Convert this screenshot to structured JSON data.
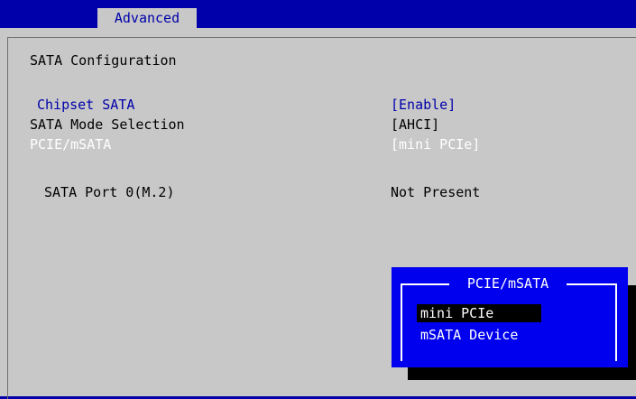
{
  "tabs": {
    "active": "Advanced"
  },
  "page": {
    "title": "SATA Configuration"
  },
  "settings": [
    {
      "label": "Chipset SATA",
      "value": "[Enable]"
    },
    {
      "label": "SATA Mode Selection",
      "value": "[AHCI]"
    },
    {
      "label": "PCIE/mSATA",
      "value": "[mini PCIe]"
    }
  ],
  "port": {
    "label": "SATA Port 0(M.2)",
    "value": "Not Present"
  },
  "popup": {
    "title": "PCIE/mSATA",
    "options": [
      "mini PCIe",
      "mSATA Device"
    ],
    "selected": "mini PCIe"
  },
  "colors": {
    "background": "#0000aa",
    "panel": "#c8c8c8",
    "popup": "#0000ee",
    "highlight": "#000000"
  }
}
